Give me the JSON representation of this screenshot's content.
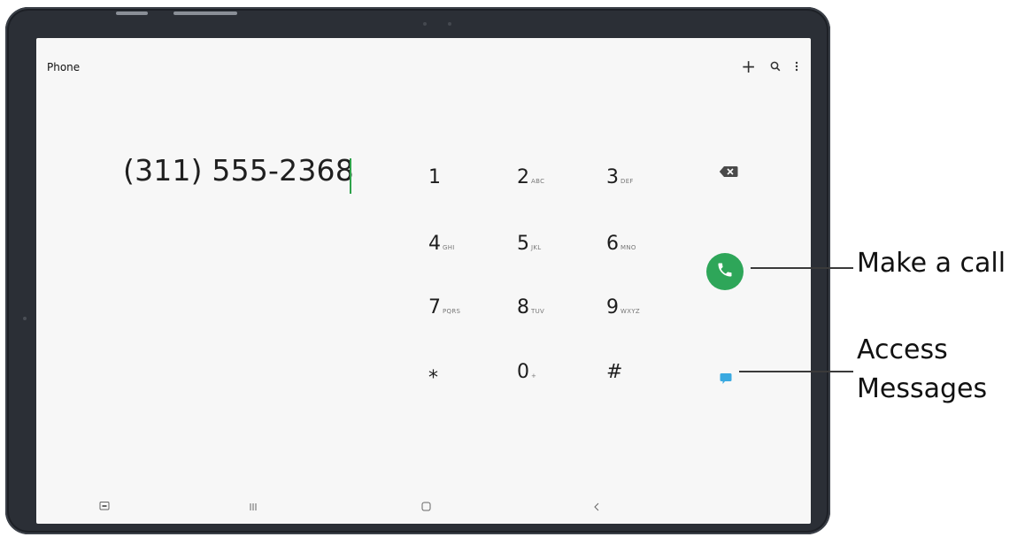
{
  "app": {
    "title": "Phone"
  },
  "toolbar": {
    "add_icon": "plus-icon",
    "search_icon": "search-icon",
    "more_icon": "more-vertical-icon"
  },
  "dialer": {
    "number": "(311) 555-2368",
    "keys": [
      {
        "digit": "1",
        "letters": ""
      },
      {
        "digit": "2",
        "letters": "ABC"
      },
      {
        "digit": "3",
        "letters": "DEF"
      },
      {
        "digit": "4",
        "letters": "GHI"
      },
      {
        "digit": "5",
        "letters": "JKL"
      },
      {
        "digit": "6",
        "letters": "MNO"
      },
      {
        "digit": "7",
        "letters": "PQRS"
      },
      {
        "digit": "8",
        "letters": "TUV"
      },
      {
        "digit": "9",
        "letters": "WXYZ"
      },
      {
        "digit": "⁎",
        "letters": ""
      },
      {
        "digit": "0",
        "letters": "+"
      },
      {
        "digit": "#",
        "letters": ""
      }
    ]
  },
  "actions": {
    "call_color": "#2ea659",
    "message_color": "#3aa9e0"
  },
  "callouts": {
    "call": "Make a call",
    "messages_line1": "Access",
    "messages_line2": "Messages"
  }
}
